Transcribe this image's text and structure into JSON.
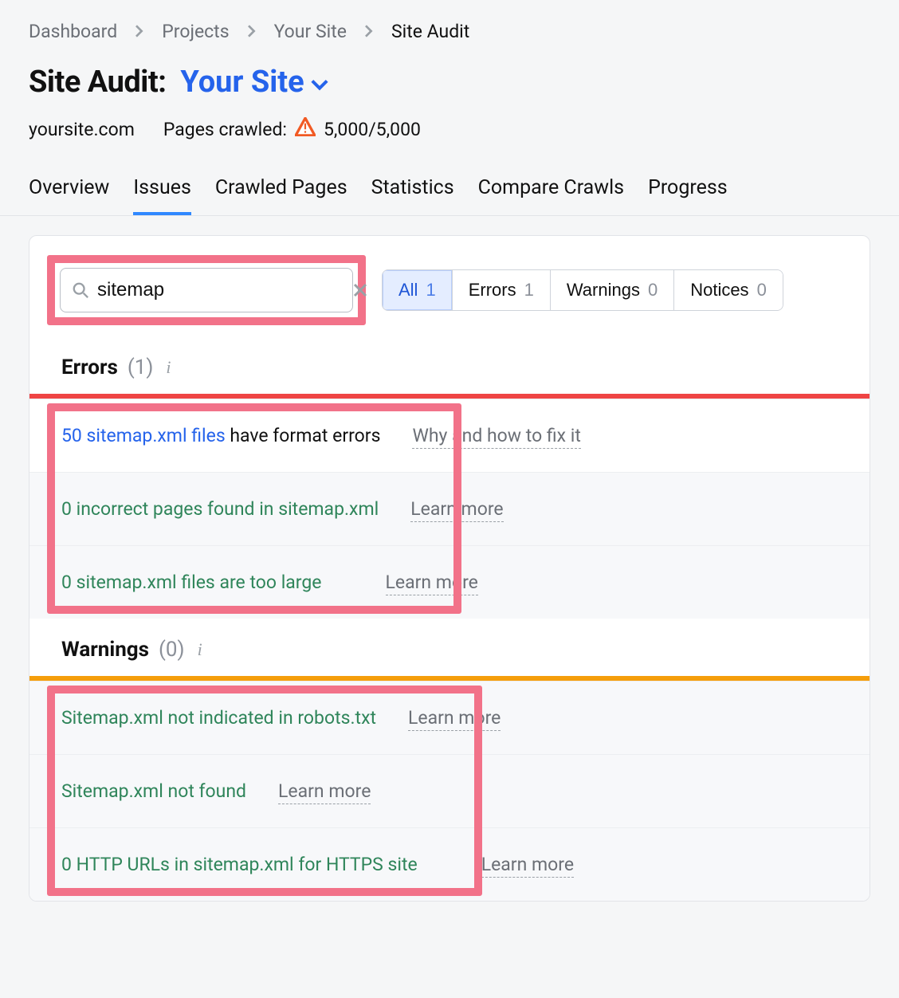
{
  "breadcrumbs": {
    "items": [
      {
        "label": "Dashboard"
      },
      {
        "label": "Projects"
      },
      {
        "label": "Your Site"
      }
    ],
    "current": "Site Audit"
  },
  "header": {
    "title_prefix": "Site Audit:",
    "site_name": "Your Site",
    "domain": "yoursite.com",
    "crawled_label": "Pages crawled:",
    "crawled_value": "5,000/5,000"
  },
  "tabs": [
    {
      "id": "overview",
      "label": "Overview"
    },
    {
      "id": "issues",
      "label": "Issues",
      "active": true
    },
    {
      "id": "crawled",
      "label": "Crawled Pages"
    },
    {
      "id": "statistics",
      "label": "Statistics"
    },
    {
      "id": "compare",
      "label": "Compare Crawls"
    },
    {
      "id": "progress",
      "label": "Progress"
    }
  ],
  "filters": {
    "search_value": "sitemap",
    "seg": {
      "all": {
        "label": "All",
        "count": "1"
      },
      "errors": {
        "label": "Errors",
        "count": "1"
      },
      "warnings": {
        "label": "Warnings",
        "count": "0"
      },
      "notices": {
        "label": "Notices",
        "count": "0"
      }
    }
  },
  "sections": {
    "errors": {
      "title": "Errors",
      "count_display": "(1)",
      "issues": [
        {
          "link_text": "50 sitemap.xml files",
          "rest": " have format errors",
          "help": "Why and how to fix it",
          "muted": false
        },
        {
          "link_text": "0 incorrect pages found in sitemap.xml",
          "rest": "",
          "help": "Learn more",
          "muted": true
        },
        {
          "link_text": "0 sitemap.xml files are too large",
          "rest": "",
          "help": "Learn more",
          "muted": true
        }
      ]
    },
    "warnings": {
      "title": "Warnings",
      "count_display": "(0)",
      "issues": [
        {
          "link_text": "Sitemap.xml not indicated in robots.txt",
          "rest": "",
          "help": "Learn more",
          "muted": true
        },
        {
          "link_text": "Sitemap.xml not found",
          "rest": "",
          "help": "Learn more",
          "muted": true
        },
        {
          "link_text": "0 HTTP URLs in sitemap.xml for HTTPS site",
          "rest": "",
          "help": "Learn more",
          "muted": true
        }
      ]
    }
  }
}
